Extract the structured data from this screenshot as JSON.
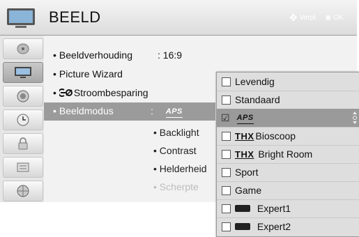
{
  "header": {
    "title": "BEELD",
    "hint_move": "Verpl.",
    "hint_ok": "OK"
  },
  "sidebar": {
    "items": [
      {
        "icon": "satellite-dish-icon"
      },
      {
        "icon": "picture-tv-icon",
        "active": true
      },
      {
        "icon": "speaker-icon"
      },
      {
        "icon": "clock-icon"
      },
      {
        "icon": "lock-icon"
      },
      {
        "icon": "options-icon"
      },
      {
        "icon": "network-globe-icon"
      }
    ]
  },
  "menu": {
    "items": [
      {
        "bullet": "•",
        "label": "Beeldverhouding",
        "value": ": 16:9"
      },
      {
        "bullet": "•",
        "label": "Picture Wizard",
        "value": ""
      },
      {
        "bullet": "•",
        "label": "Stroombesparing",
        "value": ""
      },
      {
        "bullet": "•",
        "label": "Beeldmodus",
        "value": ":"
      }
    ],
    "beeldmodus_value": "APS",
    "sub_items": [
      {
        "label": "• Backlight"
      },
      {
        "label": "• Contrast"
      },
      {
        "label": "• Helderheid"
      },
      {
        "label": "• Scherpte",
        "dim": true
      }
    ]
  },
  "dropdown": {
    "options": [
      {
        "label": "Levendig",
        "checked": false
      },
      {
        "label": "Standaard",
        "checked": false
      },
      {
        "label": "APS",
        "checked": true
      },
      {
        "prefix": "THX",
        "label": "Bioscoop",
        "checked": false
      },
      {
        "prefix": "THX",
        "label": " Bright Room",
        "checked": false
      },
      {
        "label": "Sport",
        "checked": false
      },
      {
        "label": "Game",
        "checked": false
      },
      {
        "label": " Expert1",
        "checked": false
      },
      {
        "label": " Expert2",
        "checked": false
      }
    ]
  }
}
